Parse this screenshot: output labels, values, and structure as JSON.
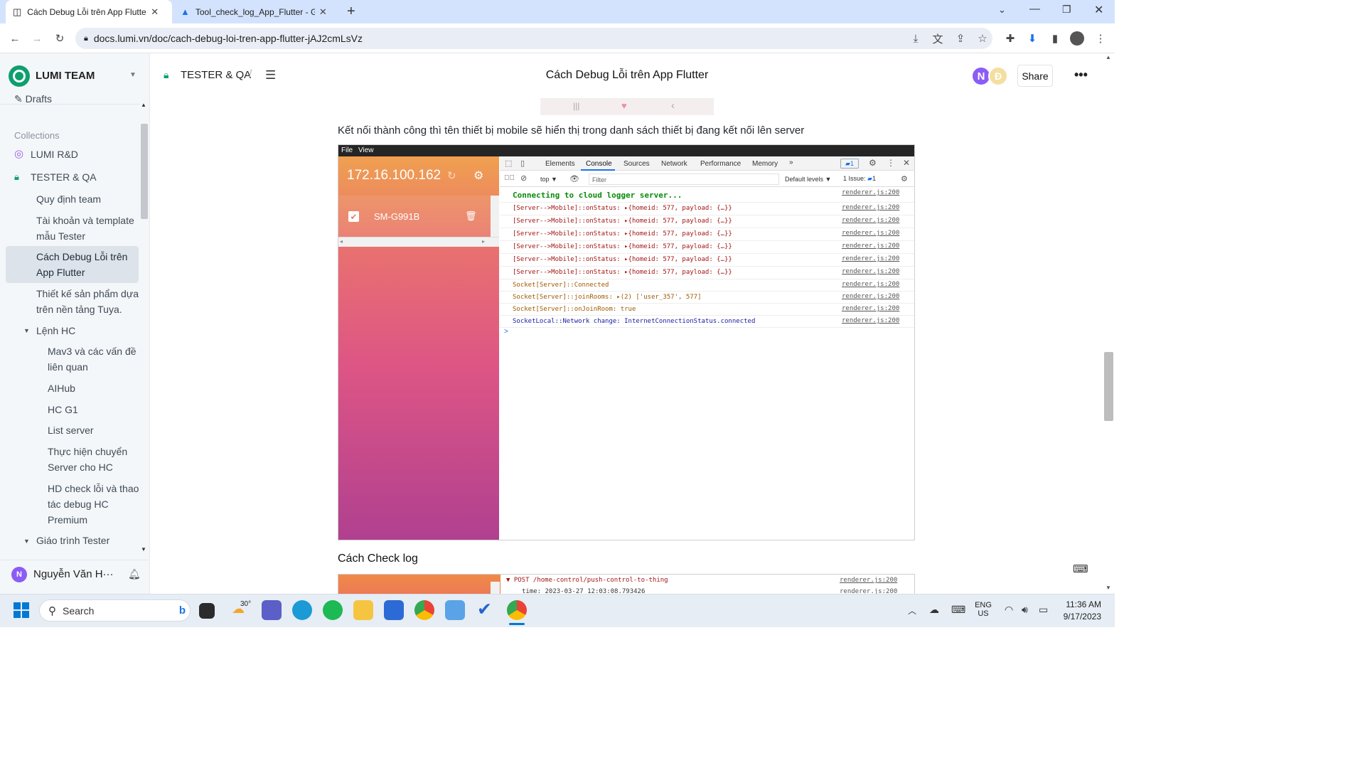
{
  "browser": {
    "tabs": [
      {
        "title": "Cách Debug Lỗi trên App Flutter",
        "active": true
      },
      {
        "title": "Tool_check_log_App_Flutter - Go",
        "active": false
      }
    ],
    "url": "docs.lumi.vn/doc/cach-debug-loi-tren-app-flutter-jAJ2cmLsVz"
  },
  "sidebar": {
    "team": "LUMI TEAM",
    "drafts": "Drafts",
    "collections_label": "Collections",
    "collections": [
      {
        "label": "LUMI R&D",
        "icon": "target-icon"
      },
      {
        "label": "TESTER & QA",
        "icon": "lock-icon"
      }
    ],
    "items": [
      "Quy định team",
      "Tài khoản và template mẫu Tester",
      "Cách Debug Lỗi trên App Flutter",
      "Thiết kế sản phẩm dựa trên nền tảng Tuya.",
      "Lệnh HC",
      "Mav3 và các vấn đề liên quan",
      "AIHub",
      "HC G1",
      "List server",
      "Thực hiện chuyển Server cho HC",
      "HD check lỗi và thao tác debug HC Premium",
      "Giáo trình Tester"
    ],
    "user": "Nguyễn Văn H···",
    "user_initial": "N"
  },
  "header": {
    "breadcrumb": "TESTER & QA",
    "breadcrumb_sep": "/",
    "title": "Cách Debug Lỗi trên App Flutter",
    "avatars": [
      "N",
      "Đ"
    ],
    "share": "Share"
  },
  "content": {
    "paragraph": "Kết nối thành công thì tên thiết bị mobile sẽ hiển thị trong danh sách thiết bị đang kết nối lên server",
    "heading2": "Cách Check log"
  },
  "app_window": {
    "menu": [
      "File",
      "View"
    ],
    "ip": "172.16.100.162",
    "device": "SM-G991B",
    "devtools_tabs": [
      "Elements",
      "Console",
      "Sources",
      "Network",
      "Performance",
      "Memory",
      "»"
    ],
    "badge_count": "1",
    "context": "top ▼",
    "filter_placeholder": "Filter",
    "levels": "Default levels ▼",
    "issues": "1 Issue:",
    "issues_count": "1",
    "prompt": ">",
    "logs": [
      {
        "text": "Connecting to cloud logger server...",
        "src": "renderer.js:200"
      },
      {
        "text": "[Server-->Mobile]::onStatus: ▸{homeid: 577, payload: {…}}",
        "src": "renderer.js:200"
      },
      {
        "text": "[Server-->Mobile]::onStatus: ▸{homeid: 577, payload: {…}}",
        "src": "renderer.js:200"
      },
      {
        "text": "[Server-->Mobile]::onStatus: ▸{homeid: 577, payload: {…}}",
        "src": "renderer.js:200"
      },
      {
        "text": "[Server-->Mobile]::onStatus: ▸{homeid: 577, payload: {…}}",
        "src": "renderer.js:200"
      },
      {
        "text": "[Server-->Mobile]::onStatus: ▸{homeid: 577, payload: {…}}",
        "src": "renderer.js:200"
      },
      {
        "text": "[Server-->Mobile]::onStatus: ▸{homeid: 577, payload: {…}}",
        "src": "renderer.js:200"
      },
      {
        "text": "Socket[Server]::Connected",
        "src": "renderer.js:200"
      },
      {
        "text": "Socket[Server]::joinRooms: ▸(2) ['user_357', 577]",
        "src": "renderer.js:200"
      },
      {
        "text": "Socket[Server]::onJoinRoom: true",
        "src": "renderer.js:200"
      },
      {
        "text": "SocketLocal::Network change: InternetConnectionStatus.connected",
        "src": "renderer.js:200"
      }
    ]
  },
  "second_window": {
    "log1": "▼ POST /home-control/push-control-to-thing",
    "log1_src": "renderer.js:200",
    "log2": "time: 2023-03-27 12:03:08.793426",
    "log2_src": "renderer.js:200"
  },
  "taskbar": {
    "search": "Search",
    "weather": "30°",
    "lang": "ENG",
    "region": "US",
    "time": "11:36 AM",
    "date": "9/17/2023"
  }
}
